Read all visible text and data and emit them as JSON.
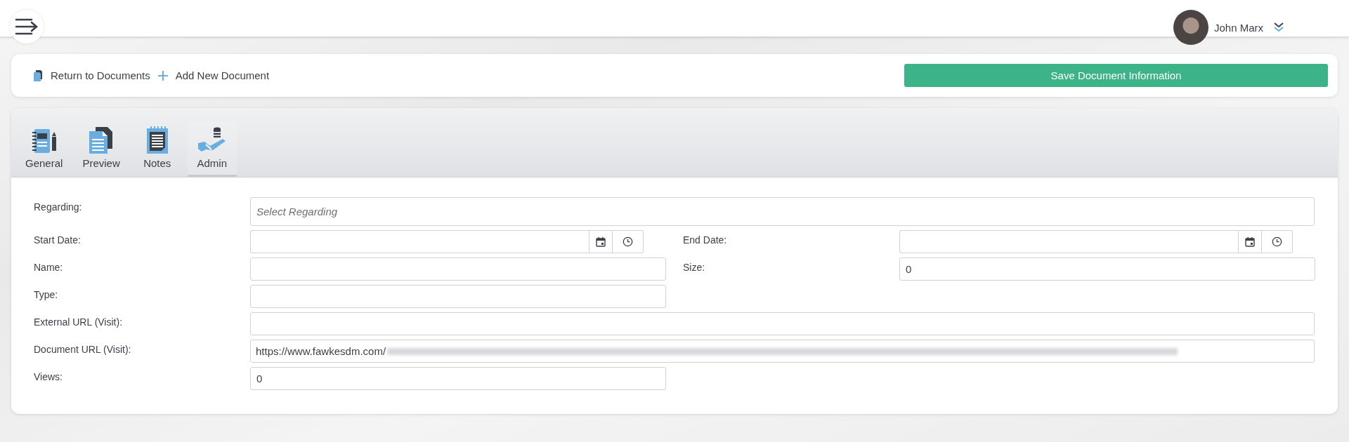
{
  "header": {
    "user_name": "John Marx"
  },
  "toolbar": {
    "links": [
      {
        "label": "Return to Documents",
        "kind": "document"
      },
      {
        "label": "Add New Document",
        "kind": "add"
      }
    ],
    "save_button": "Save Document Information"
  },
  "tabs": [
    {
      "label": "General",
      "kind": "notebook",
      "selected": false
    },
    {
      "label": "Preview",
      "kind": "pages",
      "selected": false
    },
    {
      "label": "Notes",
      "kind": "notepad",
      "selected": false
    },
    {
      "label": "Admin",
      "kind": "hand",
      "selected": true
    }
  ],
  "form": {
    "rows": [
      {
        "fields": [
          {
            "label": "Regarding:",
            "kind": "select",
            "placeholder": "Select Regarding"
          }
        ]
      },
      {
        "fields": [
          {
            "label": "Start Date:",
            "kind": "date"
          },
          {
            "label": "End Date:",
            "kind": "date"
          }
        ]
      },
      {
        "fields": [
          {
            "label": "Name:",
            "kind": "text"
          },
          {
            "label": "Size:",
            "kind": "text",
            "value": "0"
          }
        ]
      },
      {
        "fields": [
          {
            "label": "Type:",
            "kind": "text"
          }
        ]
      },
      {
        "fields": [
          {
            "label": "External URL (Visit):",
            "kind": "wide"
          }
        ]
      },
      {
        "fields": [
          {
            "label": "Document URL (Visit):",
            "kind": "wide",
            "value": "https://www.fawkesdm.com/",
            "redacted": true
          }
        ]
      },
      {
        "fields": [
          {
            "label": "Views:",
            "kind": "text",
            "value": "0"
          }
        ]
      }
    ]
  }
}
